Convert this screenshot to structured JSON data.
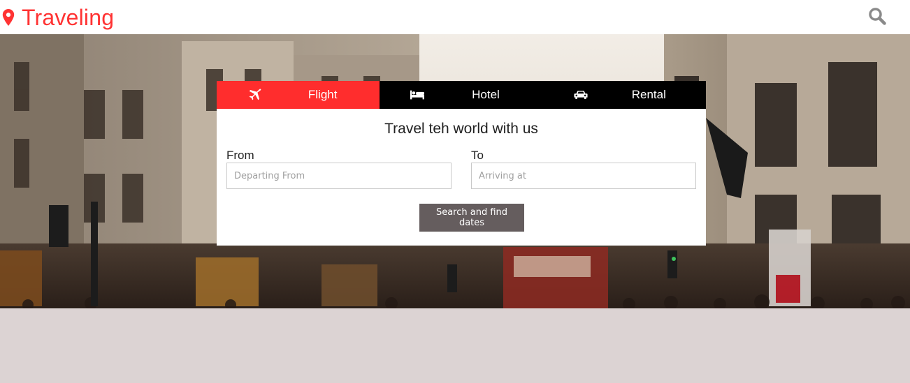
{
  "header": {
    "brand": "Traveling",
    "brand_color": "#ff3333",
    "pin_icon": "map-pin-icon",
    "search_icon": "search-icon"
  },
  "search_panel": {
    "tabs": [
      {
        "label": "Flight",
        "icon": "plane-icon",
        "active": true
      },
      {
        "label": "Hotel",
        "icon": "bed-icon",
        "active": false
      },
      {
        "label": "Rental",
        "icon": "car-icon",
        "active": false
      }
    ],
    "title": "Travel teh world with us",
    "from": {
      "label": "From",
      "placeholder": "Departing From"
    },
    "to": {
      "label": "To",
      "placeholder": "Arriving at"
    },
    "submit_label": "Search and find dates",
    "accent_color": "#ff2d2d"
  }
}
